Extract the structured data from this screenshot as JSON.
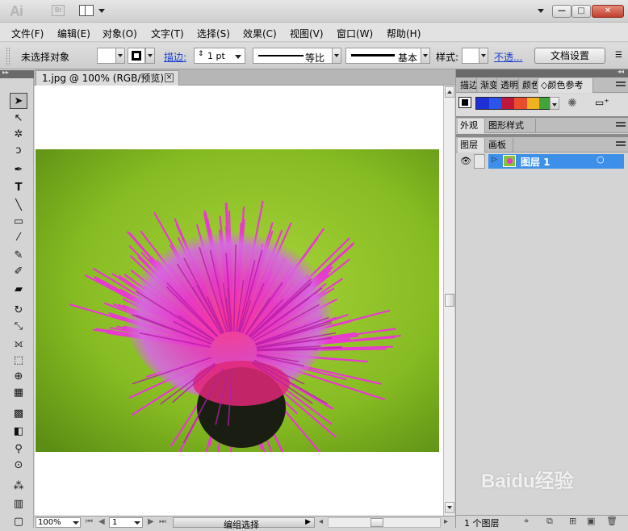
{
  "app": {
    "logo": "Ai",
    "bridge_logo": "Br"
  },
  "menu": [
    "文件(F)",
    "编辑(E)",
    "对象(O)",
    "文字(T)",
    "选择(S)",
    "效果(C)",
    "视图(V)",
    "窗口(W)",
    "帮助(H)"
  ],
  "control": {
    "selection": "未选择对象",
    "stroke_label": "描边:",
    "stroke_weight": "1 pt",
    "profile": "等比",
    "brush": "基本",
    "style_label": "样式:",
    "opacity_link": "不透...",
    "doc_setup": "文档设置"
  },
  "document": {
    "tab_title": "1.jpg @ 100% (RGB/预览)",
    "close": "×"
  },
  "status": {
    "zoom": "100%",
    "page": "1",
    "tool_name": "编组选择"
  },
  "panels": {
    "top_tabs": [
      "描边",
      "渐变",
      "透明",
      "颜色",
      "颜色参考"
    ],
    "mid_tabs": [
      "外观",
      "图形样式"
    ],
    "layer_tabs": [
      "图层",
      "画板"
    ],
    "layer_name": "图层 1",
    "layer_count": "1 个图层",
    "guide_colors": [
      "#1f2fd6",
      "#2a55e8",
      "#c1173a",
      "#e84e2c",
      "#f0b020",
      "#3fa53a"
    ]
  },
  "watermark": "Baidu经验",
  "colors": {
    "selected_layer": "#3d8fe8",
    "flower": "#e838c8",
    "background": "#7fb81e"
  },
  "icons": [
    "selection-arrow-icon",
    "direct-selection-icon",
    "magic-wand-icon",
    "lasso-icon",
    "pen-icon",
    "type-icon",
    "line-icon",
    "rectangle-icon",
    "paintbrush-icon",
    "pencil-icon",
    "blob-brush-icon",
    "eraser-icon",
    "rotate-icon",
    "scale-icon",
    "width-icon",
    "free-transform-icon",
    "shape-builder-icon",
    "perspective-icon",
    "mesh-icon",
    "gradient-icon",
    "eyedropper-icon",
    "blend-icon",
    "symbol-sprayer-icon",
    "column-graph-icon"
  ]
}
